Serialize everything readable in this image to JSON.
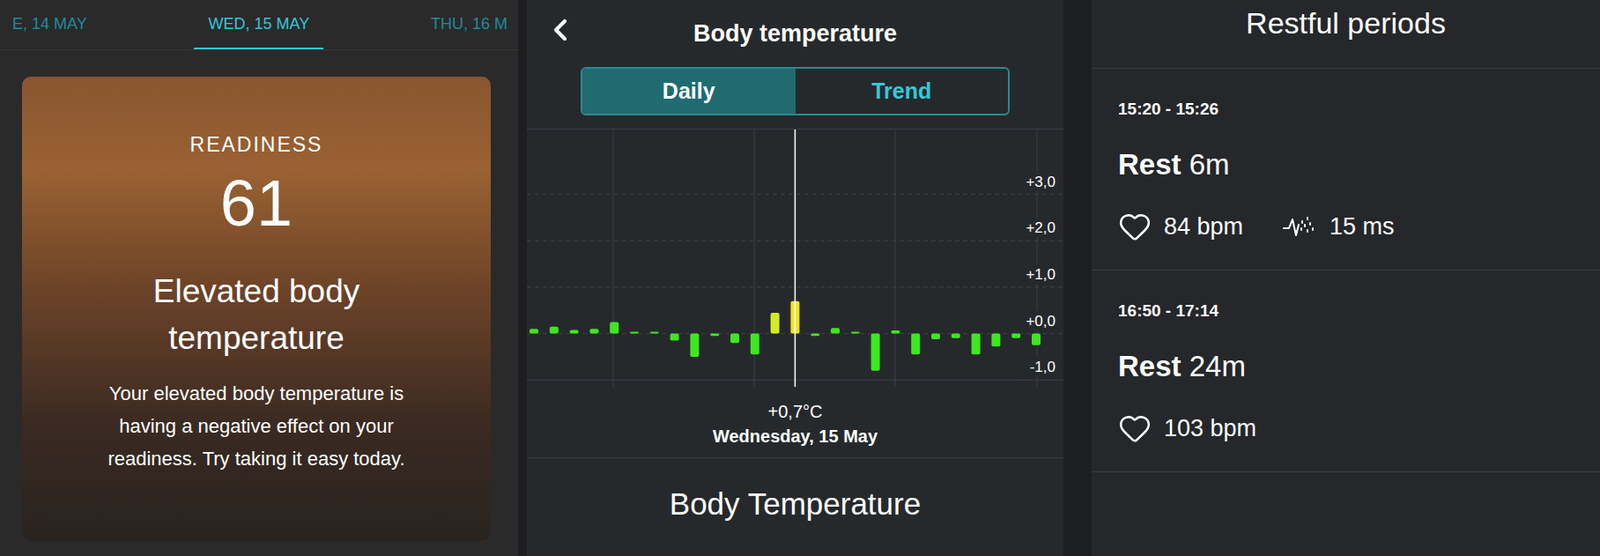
{
  "date_tabs": [
    {
      "label": "E, 14 MAY",
      "selected": false
    },
    {
      "label": "WED, 15 MAY",
      "selected": true
    },
    {
      "label": "THU, 16 M",
      "selected": false
    }
  ],
  "readiness_card": {
    "label": "READINESS",
    "score": "61",
    "title": "Elevated body temperature",
    "description": "Your elevated body temperature is having a negative effect on your readiness. Try taking it easy today."
  },
  "temperature": {
    "title": "Body temperature",
    "view_tabs": [
      {
        "label": "Daily",
        "selected": true
      },
      {
        "label": "Trend",
        "selected": false
      }
    ],
    "chart": {
      "y_ticks": [
        {
          "label": "+3,0",
          "value": 3
        },
        {
          "label": "+2,0",
          "value": 2
        },
        {
          "label": "+1,0",
          "value": 1
        },
        {
          "label": "+0,0",
          "value": 0
        },
        {
          "label": "-1,0",
          "value": -1
        }
      ],
      "values": [
        0.1,
        0.15,
        0.08,
        0.1,
        0.25,
        0,
        0,
        -0.15,
        -0.5,
        -0.05,
        -0.2,
        -0.45,
        0.45,
        0.7,
        -0.05,
        0.12,
        0,
        -0.8,
        0.07,
        -0.45,
        -0.12,
        -0.1,
        -0.45,
        -0.28,
        -0.1,
        -0.25
      ],
      "selected_index": 13
    },
    "reading": "+0,7°C",
    "date": "Wednesday, 15 May",
    "section_title": "Body Temperature"
  },
  "restful_periods": {
    "title": "Restful periods",
    "items": [
      {
        "time": "15:20 - 15:26",
        "label": "Rest",
        "duration": "6m",
        "heart_rate": "84 bpm",
        "hrv": "15 ms"
      },
      {
        "time": "16:50 - 17:14",
        "label": "Rest",
        "duration": "24m",
        "heart_rate": "103 bpm"
      }
    ]
  }
}
